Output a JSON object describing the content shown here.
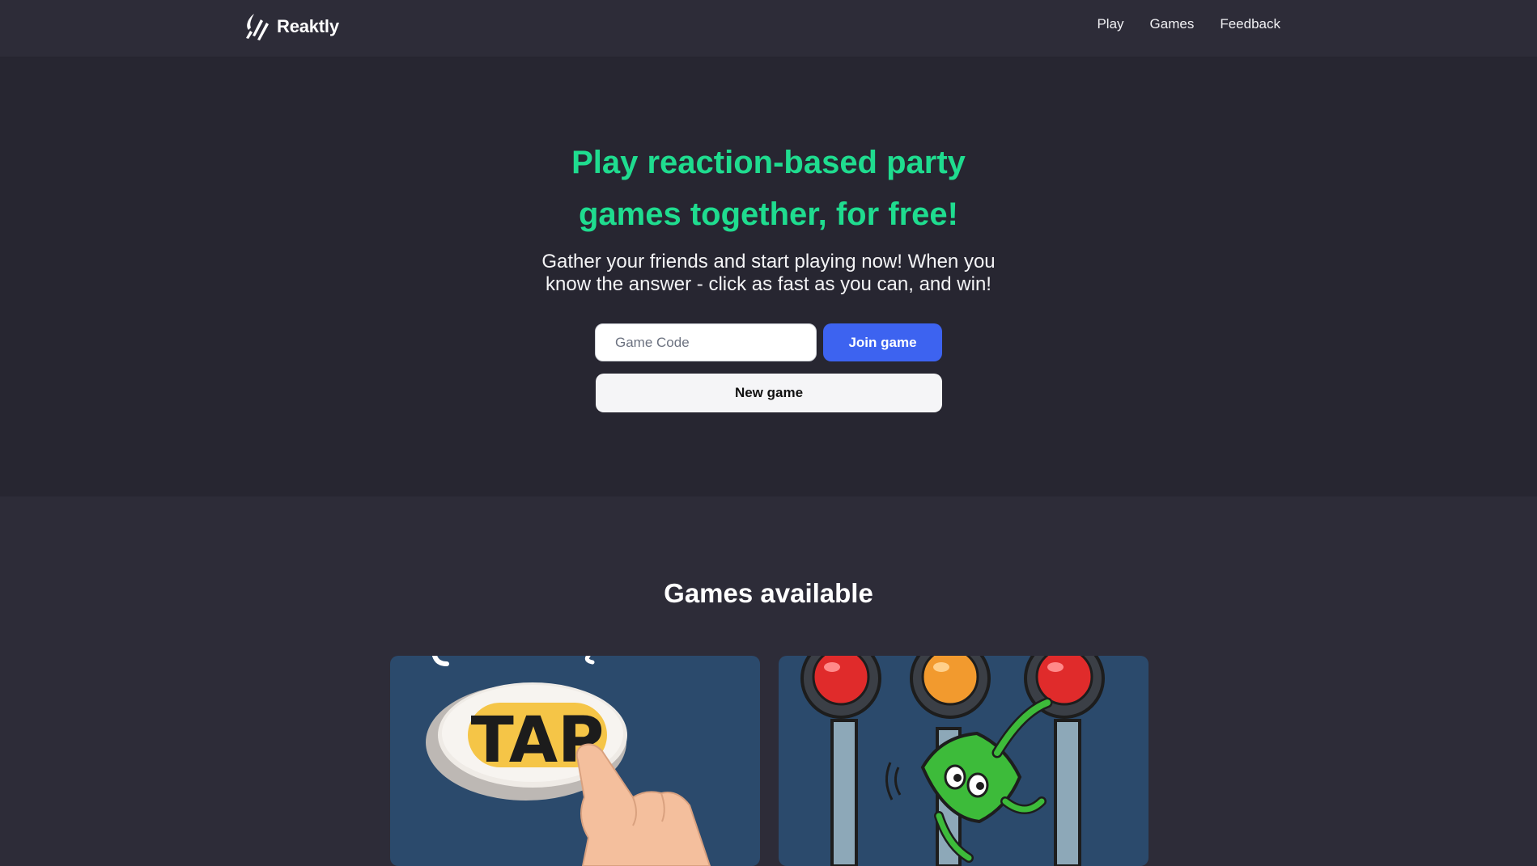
{
  "nav": {
    "brand": "Reaktly",
    "links": [
      "Play",
      "Games",
      "Feedback"
    ]
  },
  "hero": {
    "title_line1": "Play reaction-based party",
    "title_line2": "games together, for free!",
    "subtitle_line1": "Gather your friends and start playing now! When you",
    "subtitle_line2": "know the answer - click as fast as you can, and win!",
    "code_placeholder": "Game Code",
    "join_label": "Join game",
    "new_label": "New game"
  },
  "games": {
    "heading": "Games available",
    "cards": [
      {
        "art_text": "TAP",
        "art": "tap-button-illustration"
      },
      {
        "art": "traffic-light-illustration"
      }
    ]
  },
  "colors": {
    "accent_green": "#1fdc8f",
    "primary_blue": "#3d63f0",
    "hero_bg": "#272631",
    "page_bg": "#2d2c38",
    "card_bg": "#2b4a6c"
  }
}
